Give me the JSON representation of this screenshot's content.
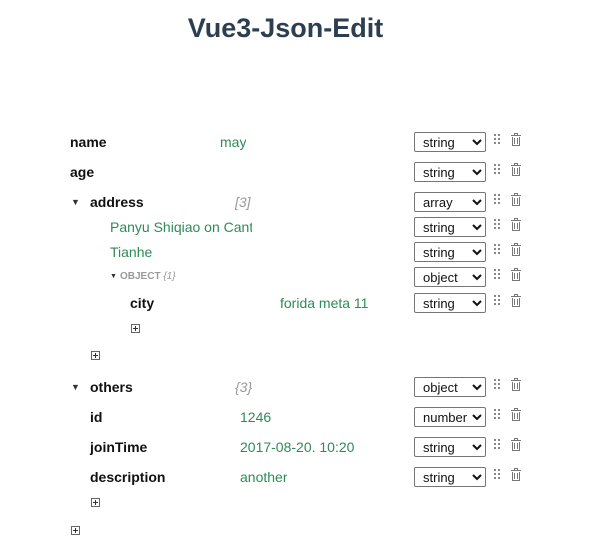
{
  "title": "Vue3-Json-Edit",
  "type_options": [
    "string",
    "number",
    "array",
    "object"
  ],
  "rows": {
    "name": {
      "key": "name",
      "value": "may",
      "type": "string"
    },
    "age": {
      "key": "age",
      "value": "",
      "type": "string"
    },
    "address": {
      "key": "address",
      "count": "[3]",
      "type": "array"
    },
    "address_0": {
      "value": "Panyu Shiqiao on Canton Avenue",
      "type": "string"
    },
    "address_1": {
      "value": "Tianhe",
      "type": "string"
    },
    "address_2": {
      "label": "OBJECT",
      "count": "{1}",
      "type": "object"
    },
    "city": {
      "key": "city",
      "value": "forida meta 11",
      "type": "string"
    },
    "others": {
      "key": "others",
      "count": "{3}",
      "type": "object"
    },
    "id": {
      "key": "id",
      "value": "1246",
      "type": "number"
    },
    "jointime": {
      "key": "joinTime",
      "value": "2017-08-20. 10:20",
      "type": "string"
    },
    "description": {
      "key": "description",
      "value": "another",
      "type": "string"
    }
  },
  "icons": {
    "toggle": "caret-down-icon",
    "drag": "drag-handle-icon",
    "delete": "trash-icon",
    "add": "plus-square-icon"
  }
}
